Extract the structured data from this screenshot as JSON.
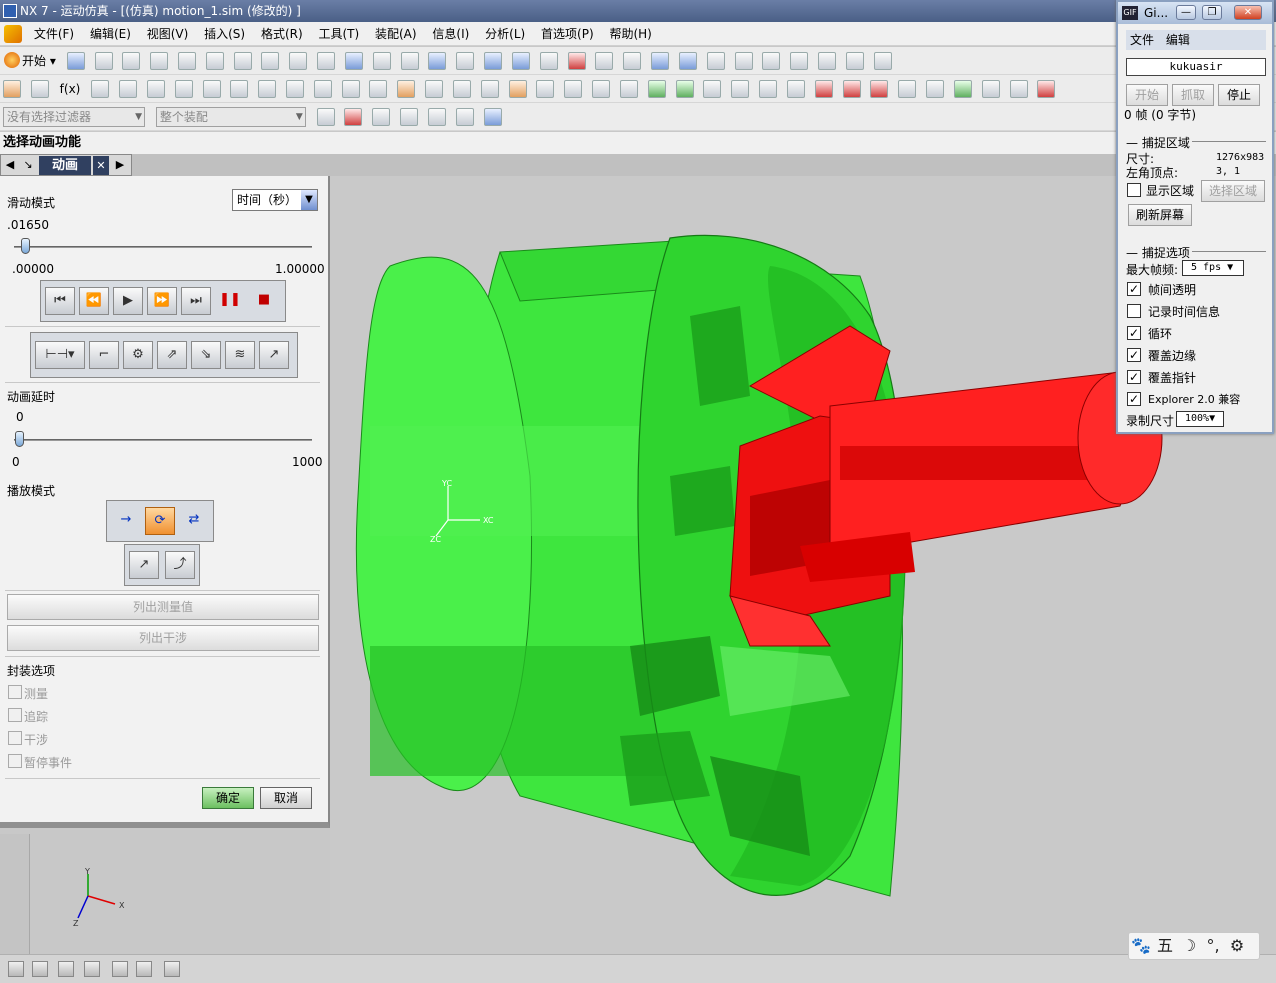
{
  "window": {
    "title": "NX 7 - 运动仿真 - [(仿真) motion_1.sim  (修改的) ]"
  },
  "menu": [
    "文件(F)",
    "编辑(E)",
    "视图(V)",
    "插入(S)",
    "格式(R)",
    "工具(T)",
    "装配(A)",
    "信息(I)",
    "分析(L)",
    "首选项(P)",
    "帮助(H)"
  ],
  "toolbar": {
    "start_label": "开始",
    "fx_label": "f(x)",
    "filter_placeholder": "没有选择过滤器",
    "assembly_placeholder": "整个装配"
  },
  "section_title": "选择动画功能",
  "panel": {
    "tab_label": "动画",
    "slide_mode_label": "滑动模式",
    "slide_mode_value": "时间（秒）",
    "current_time": ".01650",
    "time_fraction": 0.0165,
    "range_min": ".00000",
    "range_max": "1.00000",
    "anim_delay_label": "动画延时",
    "anim_delay_value": "0",
    "delay_min": "0",
    "delay_max": "1000",
    "playback_mode_label": "播放模式",
    "list_measure_label": "列出测量值",
    "list_interference_label": "列出干涉",
    "pack_options_label": "封装选项",
    "options": [
      "测量",
      "追踪",
      "干涉",
      "暂停事件"
    ],
    "ok_label": "确定",
    "cancel_label": "取消"
  },
  "viewport": {
    "triad_small": {
      "x": "XC",
      "y": "YC",
      "z": "ZC"
    },
    "triad_corner": {
      "x": "X",
      "y": "Y",
      "z": "Z"
    }
  },
  "gif_window": {
    "title": "Gi...",
    "menu": [
      "文件",
      "编辑"
    ],
    "name_field": "kukuasir",
    "start_label": "开始",
    "capture_label": "抓取",
    "stop_label": "停止",
    "frame_info": "0 帧 (0 字节)",
    "capture_area_label": "捕捉区域",
    "size_label": "尺寸:",
    "size_value": "1276x983",
    "corner_label": "左角顶点:",
    "corner_value": "3, 1",
    "show_area_label": "显示区域",
    "select_area_label": "选择区域",
    "refresh_label": "刷新屏幕",
    "capture_options_label": "捕捉选项",
    "max_fps_label": "最大帧频:",
    "max_fps_value": "5 fps",
    "options": [
      {
        "label": "帧间透明",
        "checked": true
      },
      {
        "label": "记录时间信息",
        "checked": false
      },
      {
        "label": "循环",
        "checked": true
      },
      {
        "label": "覆盖边缘",
        "checked": true
      },
      {
        "label": "覆盖指针",
        "checked": true
      },
      {
        "label": "Explorer 2.0 兼容",
        "checked": true
      }
    ],
    "record_size_label": "录制尺寸",
    "record_size_value": "100%"
  },
  "ime": [
    "🐾",
    "五",
    "☽",
    "°,",
    "⚙"
  ],
  "colors": {
    "green_part": "#2ee02e",
    "red_part": "#ff1a1a",
    "accent": "#304060"
  }
}
